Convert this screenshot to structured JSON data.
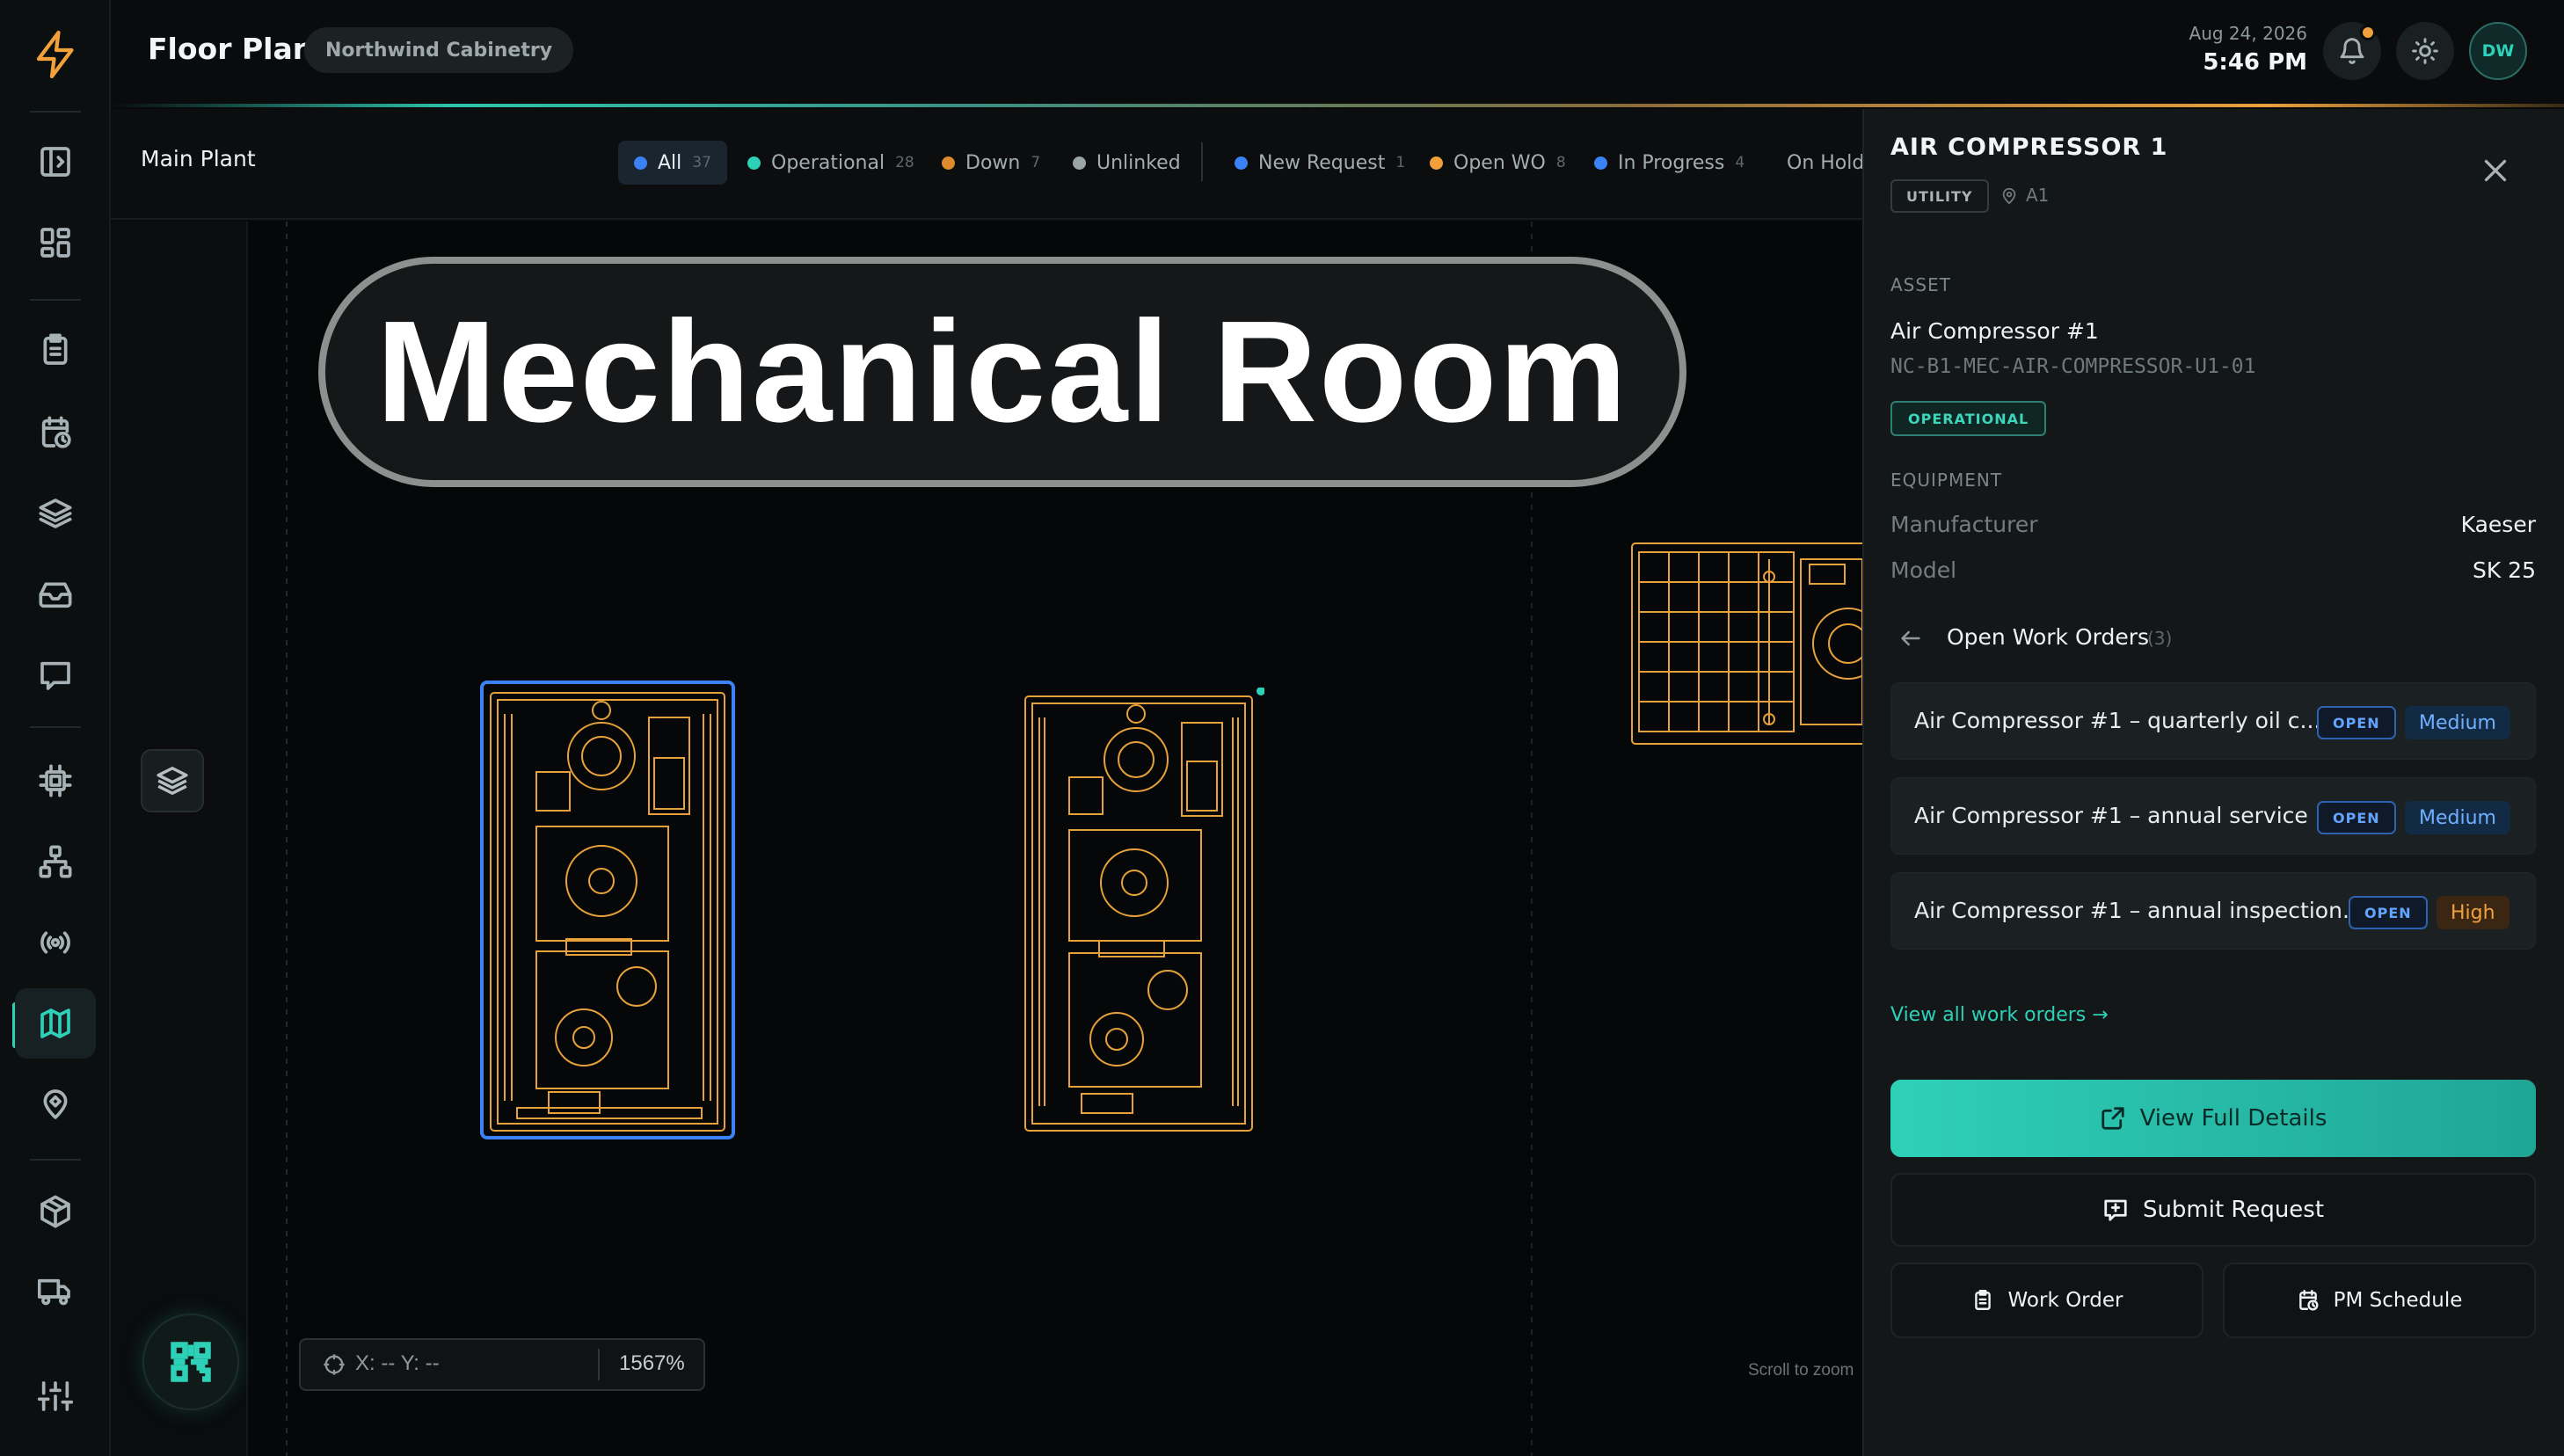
{
  "colors": {
    "accent": "#2ed1b8",
    "equipment_outline": "#e7a13b",
    "selected_outline": "#3b82f6",
    "panel_bg": "#141718"
  },
  "rail": {
    "items": [
      "collapse-sidebar-icon",
      "dashboard-icon",
      "clipboard-icon",
      "calendar-clock-icon",
      "layers-icon",
      "inbox-icon",
      "chat-icon",
      "chip-icon",
      "org-chart-icon",
      "broadcast-icon",
      "map-icon",
      "location-icon",
      "package-icon",
      "truck-icon",
      "settings-icon"
    ],
    "active": "map-icon"
  },
  "header": {
    "title": "Floor Plan",
    "organization": "Northwind Cabinetry",
    "date": "Aug 24, 2026",
    "time": "5:46 PM",
    "avatar_initials": "DW"
  },
  "toolbar": {
    "plant": "Main Plant",
    "filters": [
      {
        "label": "All",
        "count": "37",
        "color": "#3b82f6",
        "selected": true
      },
      {
        "label": "Operational",
        "count": "28",
        "color": "#2ed1b8"
      },
      {
        "label": "Down",
        "count": "7",
        "color": "#e08a2e"
      },
      {
        "label": "Unlinked",
        "count": "",
        "color": "#9aa3a6"
      }
    ],
    "wo_filters": [
      {
        "label": "New Request",
        "count": "1",
        "color": "#3b82f6"
      },
      {
        "label": "Open WO",
        "count": "8",
        "color": "#f2a13a"
      },
      {
        "label": "In Progress",
        "count": "4",
        "color": "#3b82f6"
      },
      {
        "label": "On Hold",
        "count": "",
        "color": "#f2a13a"
      }
    ]
  },
  "canvas": {
    "room_label": "Mechanical Room",
    "coordinates": "X: -- Y: --",
    "zoom": "1567%",
    "scroll_hint": "Scroll to zoom"
  },
  "panel": {
    "title": "AIR COMPRESSOR 1",
    "type_badge": "UTILITY",
    "location": "A1",
    "asset_section": "ASSET",
    "asset_name": "Air Compressor #1",
    "asset_code": "NC-B1-MEC-AIR-COMPRESSOR-U1-01",
    "status": "OPERATIONAL",
    "equipment_section": "EQUIPMENT",
    "manufacturer_label": "Manufacturer",
    "manufacturer": "Kaeser",
    "model_label": "Model",
    "model": "SK 25",
    "work_orders_heading": "Open Work Orders",
    "work_orders_count": "(3)",
    "work_orders": [
      {
        "title": "Air Compressor #1 – quarterly oil c...",
        "status": "OPEN",
        "priority": "Medium"
      },
      {
        "title": "Air Compressor #1 – annual service",
        "status": "OPEN",
        "priority": "Medium"
      },
      {
        "title": "Air Compressor #1 – annual inspection...",
        "status": "OPEN",
        "priority": "High"
      }
    ],
    "view_all": "View all work orders →",
    "btn_details": "View Full Details",
    "btn_request": "Submit Request",
    "btn_work_order": "Work Order",
    "btn_pm": "PM Schedule"
  }
}
